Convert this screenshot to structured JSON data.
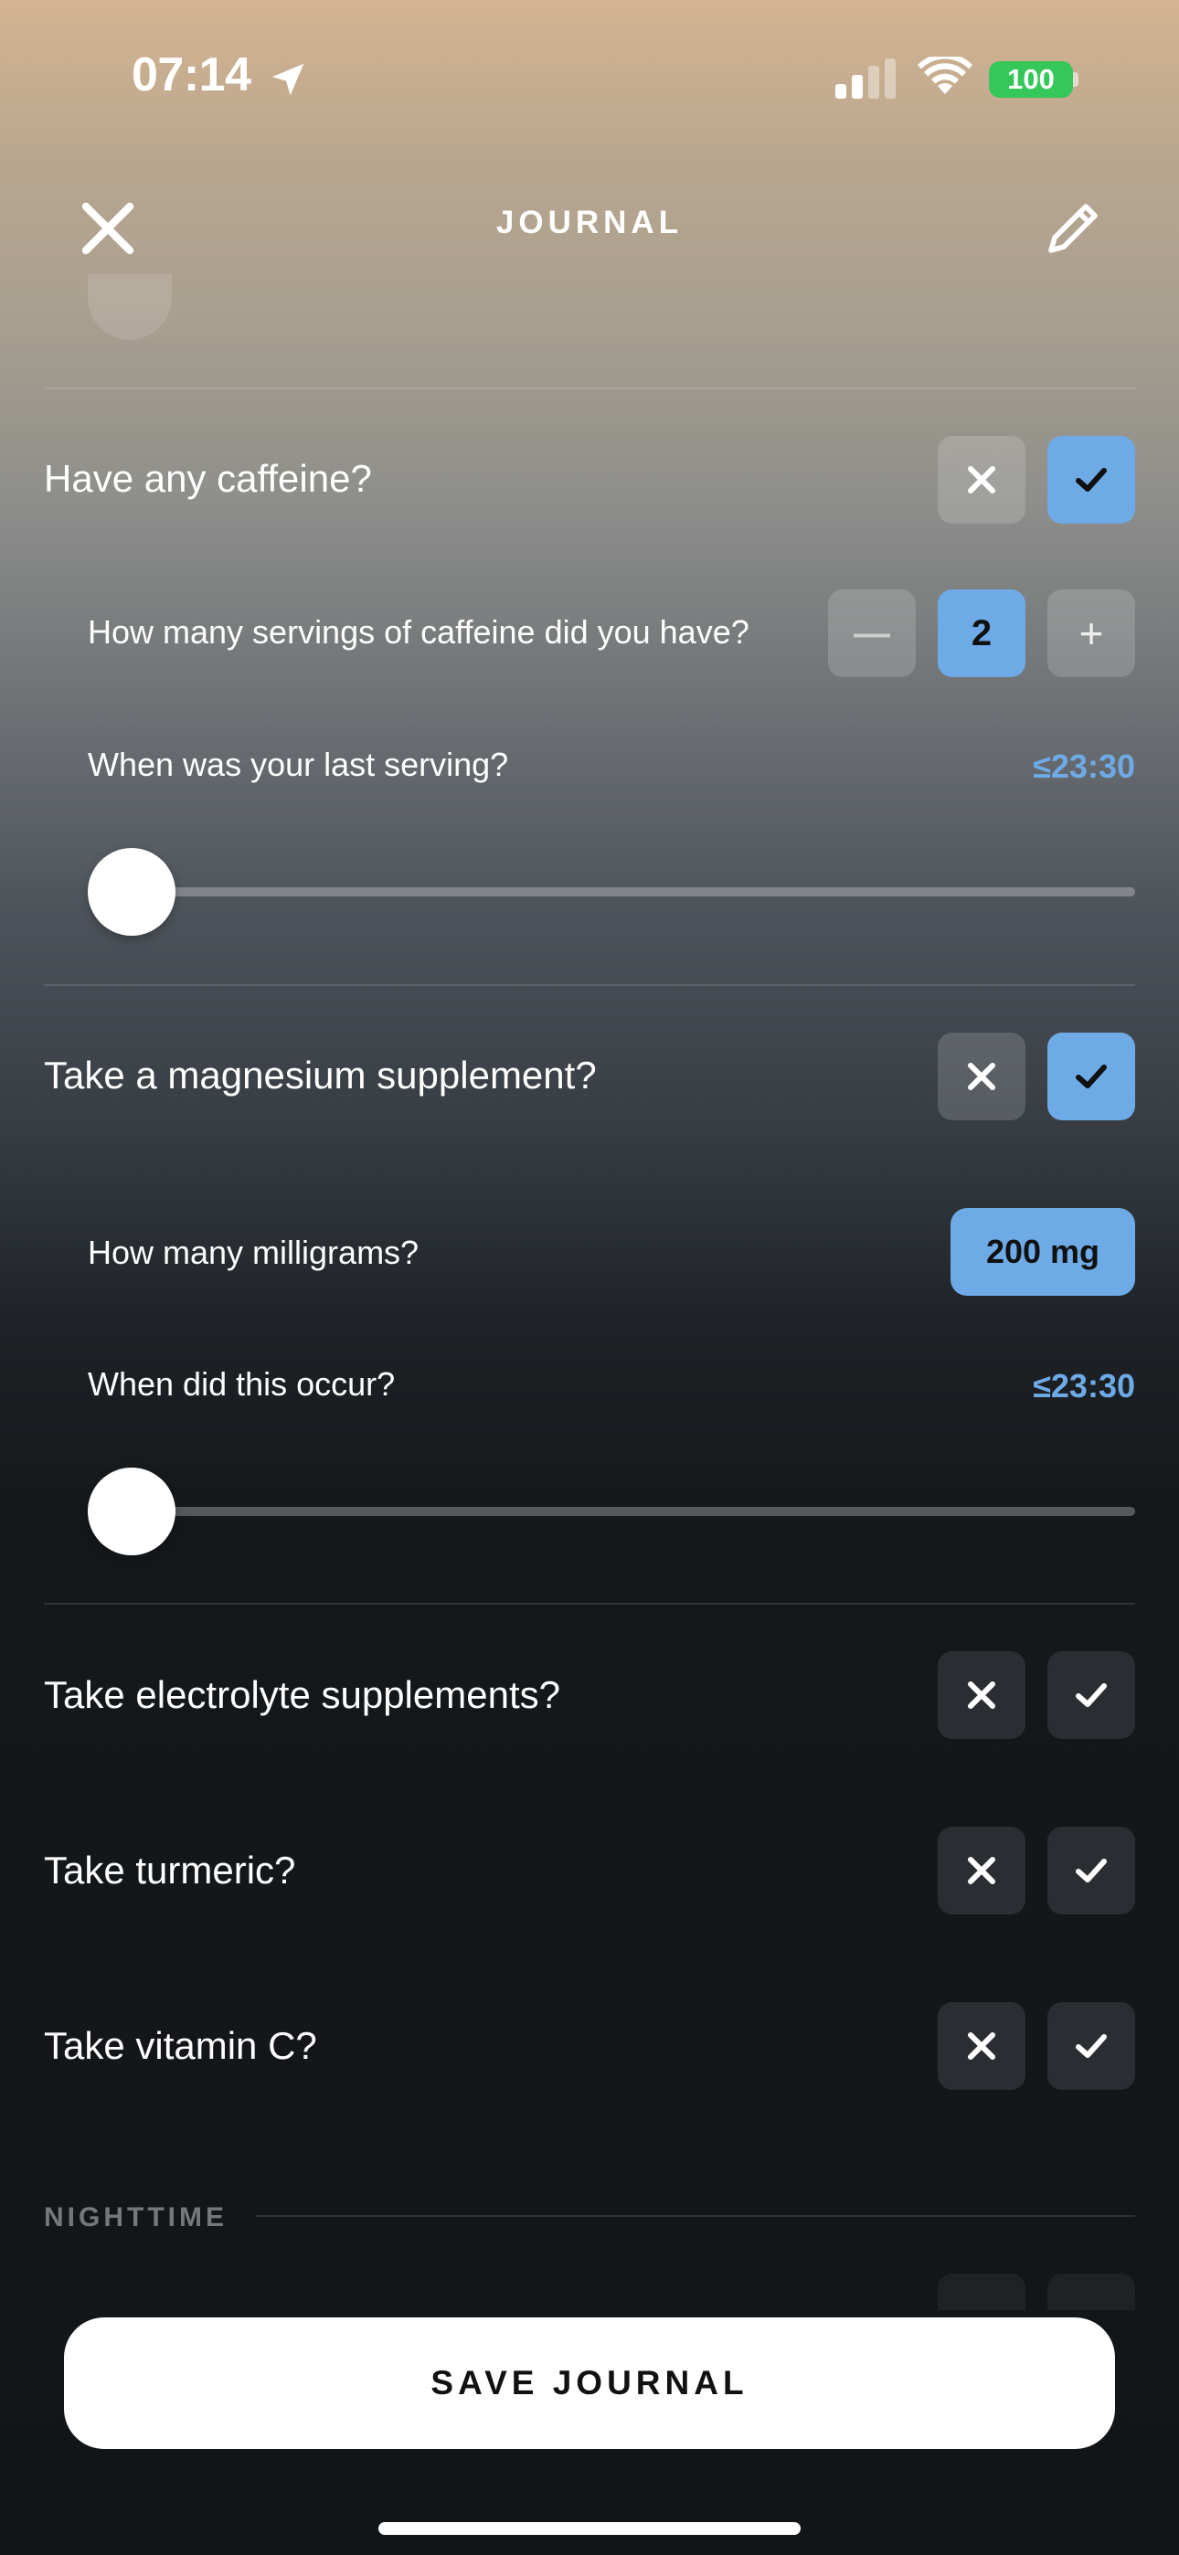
{
  "status_bar": {
    "time": "07:14",
    "battery": "100",
    "battery_color": "#35c759",
    "icons": [
      "location-arrow-icon",
      "cellular-signal-icon",
      "wifi-icon",
      "battery-icon"
    ]
  },
  "header": {
    "title": "JOURNAL",
    "close_icon": "close-icon",
    "edit_icon": "pencil-icon"
  },
  "questions": {
    "caffeine": {
      "label": "Have any caffeine?",
      "answer": "yes",
      "servings_label": "How many servings of caffeine did you have?",
      "servings_value": "2",
      "stepper_minus": "—",
      "stepper_plus": "+",
      "last_serving_label": "When was your last serving?",
      "last_serving_value": "≤23:30",
      "slider_position": 0
    },
    "magnesium": {
      "label": "Take a magnesium supplement?",
      "answer": "yes",
      "amount_label": "How many milligrams?",
      "amount_value": "200 mg",
      "time_label": "When did this occur?",
      "time_value": "≤23:30",
      "slider_position": 0
    },
    "electrolyte": {
      "label": "Take electrolyte supplements?",
      "answer": "none"
    },
    "turmeric": {
      "label": "Take turmeric?",
      "answer": "none"
    },
    "vitamin_c": {
      "label": "Take vitamin C?",
      "answer": "none"
    }
  },
  "section": {
    "nighttime_label": "NIGHTTIME"
  },
  "footer": {
    "save_label": "SAVE JOURNAL"
  },
  "colors": {
    "accent_blue": "#6eaae6",
    "neutral_button": "rgba(255,255,255,0.16)",
    "dark_button": "#2a2d31"
  }
}
